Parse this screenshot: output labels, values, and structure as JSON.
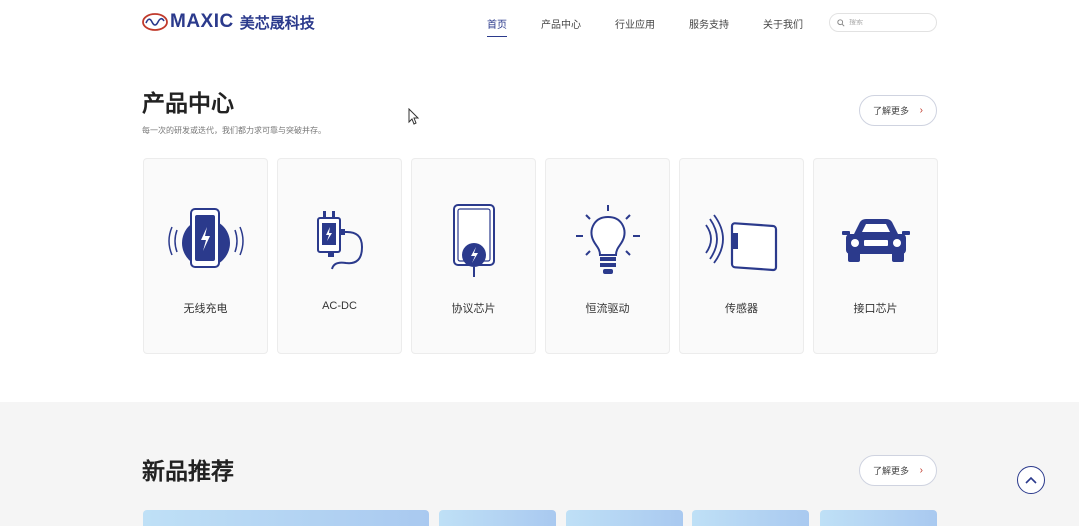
{
  "header": {
    "logo_text": "MAXIC",
    "logo_cn": "美芯晟科技",
    "nav": [
      {
        "label": "首页",
        "active": true
      },
      {
        "label": "产品中心",
        "active": false
      },
      {
        "label": "行业应用",
        "active": false
      },
      {
        "label": "服务支持",
        "active": false
      },
      {
        "label": "关于我们",
        "active": false
      }
    ],
    "search_placeholder": "搜索"
  },
  "products": {
    "title": "产品中心",
    "subtitle": "每一次的研发或迭代，我们都力求可靠与突破并存。",
    "more_label": "了解更多",
    "items": [
      {
        "label": "无线充电",
        "icon": "wireless-charging-icon"
      },
      {
        "label": "AC-DC",
        "icon": "ac-dc-adapter-icon"
      },
      {
        "label": "协议芯片",
        "icon": "protocol-chip-icon"
      },
      {
        "label": "恒流驱动",
        "icon": "led-bulb-icon"
      },
      {
        "label": "传感器",
        "icon": "sensor-icon"
      },
      {
        "label": "接口芯片",
        "icon": "car-icon"
      }
    ]
  },
  "new_products": {
    "title": "新品推荐",
    "more_label": "了解更多"
  },
  "colors": {
    "brand": "#2b3a8c",
    "accent": "#c0392b"
  }
}
